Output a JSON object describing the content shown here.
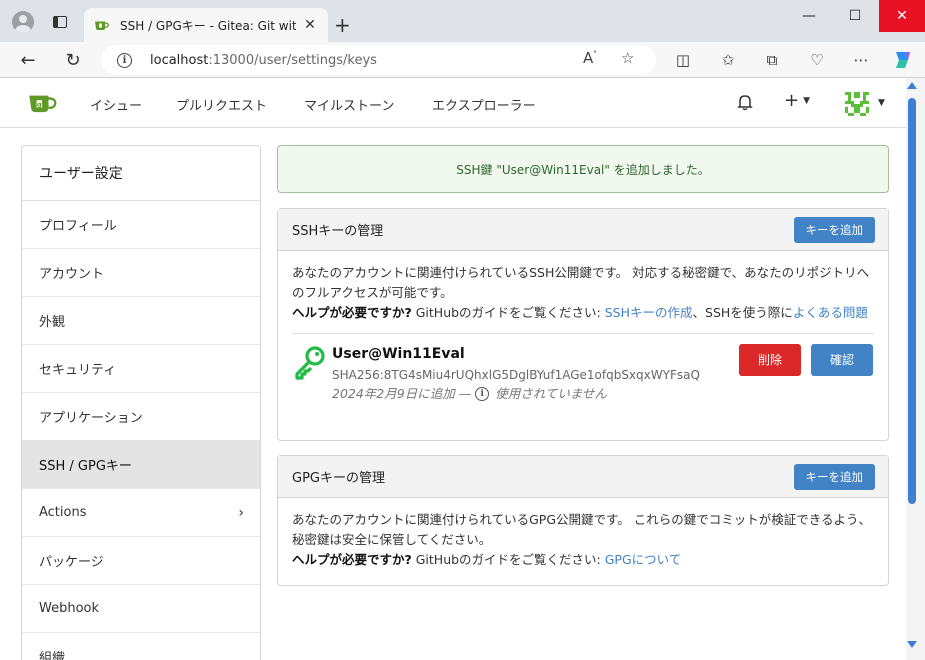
{
  "browser": {
    "tab_title": "SSH / GPGキー - Gitea: Git with a cup of tea",
    "tab_close": "✕",
    "new_tab": "+",
    "url_host": "localhost",
    "url_rest": ":13000/user/settings/keys",
    "minimize": "—",
    "maximize": "☐",
    "close": "✕"
  },
  "nav": {
    "issues": "イシュー",
    "pulls": "プルリクエスト",
    "milestones": "マイルストーン",
    "explore": "エクスプローラー",
    "plus": "+"
  },
  "sidebar": {
    "header": "ユーザー設定",
    "items": [
      {
        "label": "プロフィール"
      },
      {
        "label": "アカウント"
      },
      {
        "label": "外観"
      },
      {
        "label": "セキュリティ"
      },
      {
        "label": "アプリケーション"
      },
      {
        "label": "SSH / GPGキー"
      },
      {
        "label": "Actions"
      },
      {
        "label": "パッケージ"
      },
      {
        "label": "Webhook"
      },
      {
        "label": "組織"
      }
    ]
  },
  "flash": "SSH鍵 \"User@Win11Eval\" を追加しました。",
  "ssh": {
    "title": "SSHキーの管理",
    "add_button": "キーを追加",
    "desc": "あなたのアカウントに関連付けられているSSH公開鍵です。 対応する秘密鍵で、あなたのリポジトリへのフルアクセスが可能です。",
    "help_bold": "ヘルプが必要ですか?",
    "help_text": " GitHubのガイドをご覧ください: ",
    "help_link1": "SSHキーの作成",
    "help_mid": "、SSHを使う際に",
    "help_link2": "よくある問題",
    "key": {
      "name": "User@Win11Eval",
      "fingerprint": "SHA256:8TG4sMiu4rUQhxlG5DglBYuf1AGe1ofqbSxqxWYFsaQ",
      "added": "2024年2月9日に追加 —",
      "unused": "使用されていません",
      "delete": "削除",
      "confirm": "確認"
    }
  },
  "gpg": {
    "title": "GPGキーの管理",
    "add_button": "キーを追加",
    "desc": "あなたのアカウントに関連付けられているGPG公開鍵です。 これらの鍵でコミットが検証できるよう、秘密鍵は安全に保管してください。",
    "help_bold": "ヘルプが必要ですか?",
    "help_text": " GitHubのガイドをご覧ください: ",
    "help_link": "GPGについて"
  },
  "colors": {
    "primary": "#4183c4",
    "danger": "#db2828",
    "gitea_green": "#609926",
    "flash_bg": "#f1f8ee"
  }
}
